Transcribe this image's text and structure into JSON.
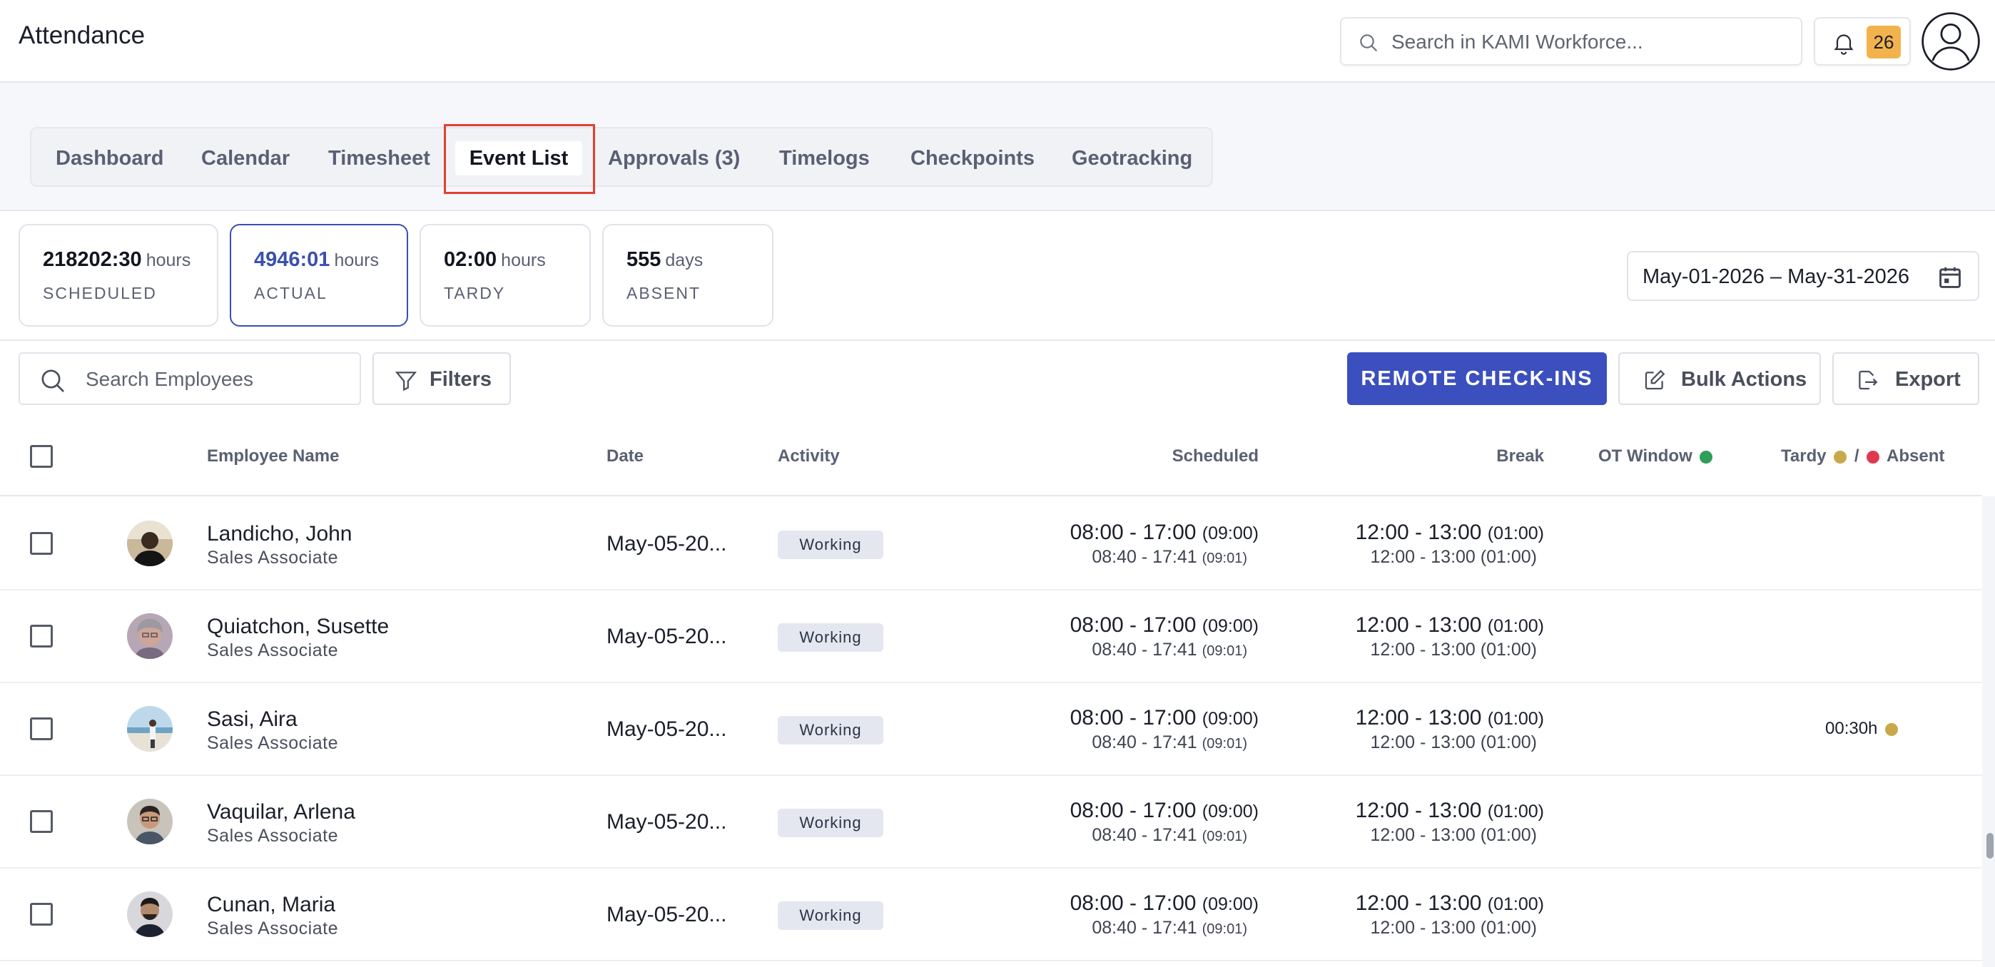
{
  "app": {
    "title": "Attendance"
  },
  "search": {
    "placeholder": "Search in KAMI Workforce..."
  },
  "notifications": {
    "count": "26"
  },
  "tabs": [
    {
      "label": "Dashboard"
    },
    {
      "label": "Calendar"
    },
    {
      "label": "Timesheet"
    },
    {
      "label": "Event List",
      "active": true
    },
    {
      "label": "Approvals (3)"
    },
    {
      "label": "Timelogs"
    },
    {
      "label": "Checkpoints"
    },
    {
      "label": "Geotracking"
    }
  ],
  "stats": [
    {
      "value": "218202:30",
      "unit": "hours",
      "label": "SCHEDULED"
    },
    {
      "value": "4946:01",
      "unit": "hours",
      "label": "ACTUAL",
      "selected": true
    },
    {
      "value": "02:00",
      "unit": "hours",
      "label": "TARDY"
    },
    {
      "value": "555",
      "unit": "days",
      "label": "ABSENT"
    }
  ],
  "date_range": "May-01-2026 – May-31-2026",
  "toolbar": {
    "search_placeholder": "Search Employees",
    "filters_label": "Filters",
    "remote_label": "REMOTE CHECK-INS",
    "bulk_label": "Bulk Actions",
    "export_label": "Export"
  },
  "table": {
    "headers": {
      "name": "Employee Name",
      "date": "Date",
      "activity": "Activity",
      "scheduled": "Scheduled",
      "break": "Break",
      "ot": "OT Window",
      "tardy": "Tardy",
      "slash": "/",
      "absent": "Absent"
    },
    "status_colors": {
      "ot": "#2e9e5b",
      "tardy": "#c9a84a",
      "absent": "#e0384f"
    },
    "rows": [
      {
        "name": "Landicho, John",
        "role": "Sales Associate",
        "date": "May-05-20...",
        "activity": "Working",
        "sched_main": "08:00 - 17:00",
        "sched_main_dur": "(09:00)",
        "sched_actual": "08:40 - 17:41",
        "sched_actual_dur": "(09:01)",
        "break_main": "12:00 - 13:00",
        "break_main_dur": "(01:00)",
        "break_actual": "12:00 - 13:00 (01:00)",
        "tardy": ""
      },
      {
        "name": "Quiatchon, Susette",
        "role": "Sales Associate",
        "date": "May-05-20...",
        "activity": "Working",
        "sched_main": "08:00 - 17:00",
        "sched_main_dur": "(09:00)",
        "sched_actual": "08:40 - 17:41",
        "sched_actual_dur": "(09:01)",
        "break_main": "12:00 - 13:00",
        "break_main_dur": "(01:00)",
        "break_actual": "12:00 - 13:00 (01:00)",
        "tardy": ""
      },
      {
        "name": "Sasi, Aira",
        "role": "Sales Associate",
        "date": "May-05-20...",
        "activity": "Working",
        "sched_main": "08:00 - 17:00",
        "sched_main_dur": "(09:00)",
        "sched_actual": "08:40 - 17:41",
        "sched_actual_dur": "(09:01)",
        "break_main": "12:00 - 13:00",
        "break_main_dur": "(01:00)",
        "break_actual": "12:00 - 13:00 (01:00)",
        "tardy": "00:30h"
      },
      {
        "name": "Vaquilar, Arlena",
        "role": "Sales Associate",
        "date": "May-05-20...",
        "activity": "Working",
        "sched_main": "08:00 - 17:00",
        "sched_main_dur": "(09:00)",
        "sched_actual": "08:40 - 17:41",
        "sched_actual_dur": "(09:01)",
        "break_main": "12:00 - 13:00",
        "break_main_dur": "(01:00)",
        "break_actual": "12:00 - 13:00 (01:00)",
        "tardy": ""
      },
      {
        "name": "Cunan, Maria",
        "role": "Sales Associate",
        "date": "May-05-20...",
        "activity": "Working",
        "sched_main": "08:00 - 17:00",
        "sched_main_dur": "(09:00)",
        "sched_actual": "08:40 - 17:41",
        "sched_actual_dur": "(09:01)",
        "break_main": "12:00 - 13:00",
        "break_main_dur": "(01:00)",
        "break_actual": "12:00 - 13:00 (01:00)",
        "tardy": ""
      }
    ]
  }
}
